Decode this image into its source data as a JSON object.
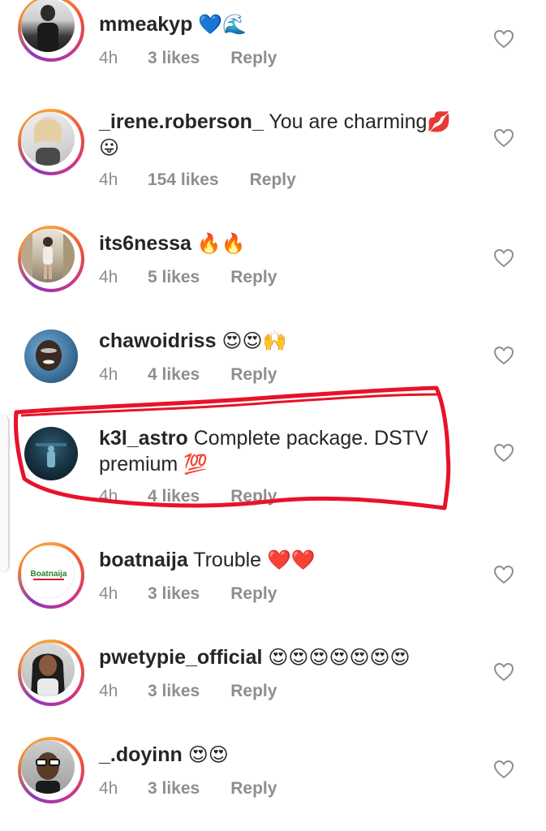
{
  "colors": {
    "text": "#262626",
    "meta": "#8e8e8e",
    "annotation": "#e8122a"
  },
  "comments": [
    {
      "username": "mmeakyp",
      "text": "",
      "emoji": "💙🌊",
      "time": "4h",
      "likes": "3 likes",
      "reply": "Reply",
      "story_ring": true,
      "avatar_icon": "profile-photo-icon"
    },
    {
      "username": "_irene.roberson_",
      "text": "You are charming",
      "emoji": "💋",
      "emoji2": "😛",
      "time": "4h",
      "likes": "154 likes",
      "reply": "Reply",
      "story_ring": true,
      "avatar_icon": "profile-photo-icon"
    },
    {
      "username": "its6nessa",
      "text": "",
      "emoji": "🔥🔥",
      "time": "4h",
      "likes": "5 likes",
      "reply": "Reply",
      "story_ring": true,
      "avatar_icon": "profile-photo-icon"
    },
    {
      "username": "chawoidriss",
      "text": "",
      "emoji": "😍😍🙌",
      "time": "4h",
      "likes": "4 likes",
      "reply": "Reply",
      "story_ring": false,
      "avatar_icon": "profile-photo-icon"
    },
    {
      "username": "k3l_astro",
      "text": "Complete package. DSTV premium",
      "emoji": "💯",
      "time": "4h",
      "likes": "4 likes",
      "reply": "Reply",
      "story_ring": false,
      "avatar_icon": "profile-photo-icon"
    },
    {
      "username": "boatnaija",
      "text": "Trouble",
      "emoji": "❤️❤️",
      "time": "4h",
      "likes": "3 likes",
      "reply": "Reply",
      "story_ring": true,
      "avatar_icon": "boatnaija-logo-icon",
      "logo_text": "Boatnaija"
    },
    {
      "username": "pwetypie_official",
      "text": "",
      "emoji": "😍😍😍😍😍😍😍",
      "time": "4h",
      "likes": "3 likes",
      "reply": "Reply",
      "story_ring": true,
      "avatar_icon": "profile-photo-icon"
    },
    {
      "username": "_.doyinn",
      "text": "",
      "emoji": "😍😍",
      "time": "4h",
      "likes": "3 likes",
      "reply": "Reply",
      "story_ring": true,
      "avatar_icon": "profile-photo-icon"
    }
  ]
}
